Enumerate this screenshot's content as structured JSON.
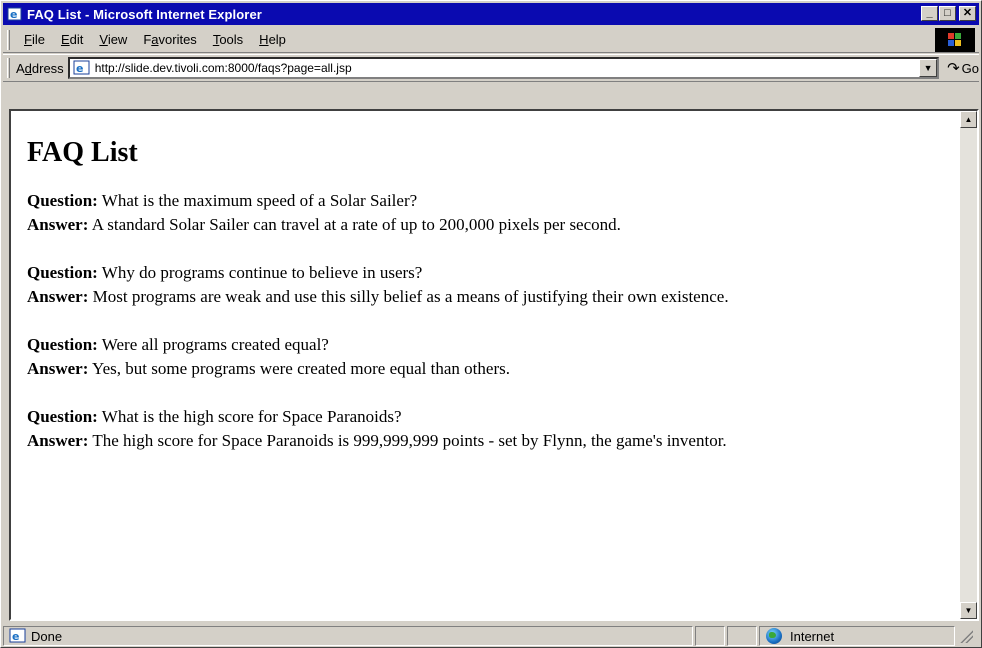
{
  "window": {
    "title": "FAQ List - Microsoft Internet Explorer",
    "controls": {
      "minimize": "_",
      "maximize": "□",
      "close": "✕"
    }
  },
  "menu": [
    {
      "label": "File",
      "accel": "F",
      "rest": "ile"
    },
    {
      "label": "Edit",
      "accel": "E",
      "rest": "dit"
    },
    {
      "label": "View",
      "accel": "V",
      "rest": "iew"
    },
    {
      "label": "Favorites",
      "pre": "F",
      "accel": "a",
      "rest": "vorites"
    },
    {
      "label": "Tools",
      "accel": "T",
      "rest": "ools"
    },
    {
      "label": "Help",
      "accel": "H",
      "rest": "elp"
    }
  ],
  "address": {
    "label_pre": "A",
    "label_accel": "d",
    "label_rest": "dress",
    "url": "http://slide.dev.tivoli.com:8000/faqs?page=all.jsp",
    "go_label": "Go"
  },
  "page": {
    "title": "FAQ List",
    "question_label": "Question:",
    "answer_label": "Answer:",
    "faqs": [
      {
        "question": "What is the maximum speed of a Solar Sailer?",
        "answer": "A standard Solar Sailer can travel at a rate of up to 200,000 pixels per second."
      },
      {
        "question": "Why do programs continue to believe in users?",
        "answer": "Most programs are weak and use this silly belief as a means of justifying their own existence."
      },
      {
        "question": "Were all programs created equal?",
        "answer": "Yes, but some programs were created more equal than others."
      },
      {
        "question": "What is the high score for Space Paranoids?",
        "answer": "The high score for Space Paranoids is 999,999,999 points - set by Flynn, the game's inventor."
      }
    ]
  },
  "status": {
    "text": "Done",
    "zone": "Internet"
  },
  "colors": {
    "titlebar": "#0a0ab0",
    "chrome": "#d4d0c8"
  }
}
